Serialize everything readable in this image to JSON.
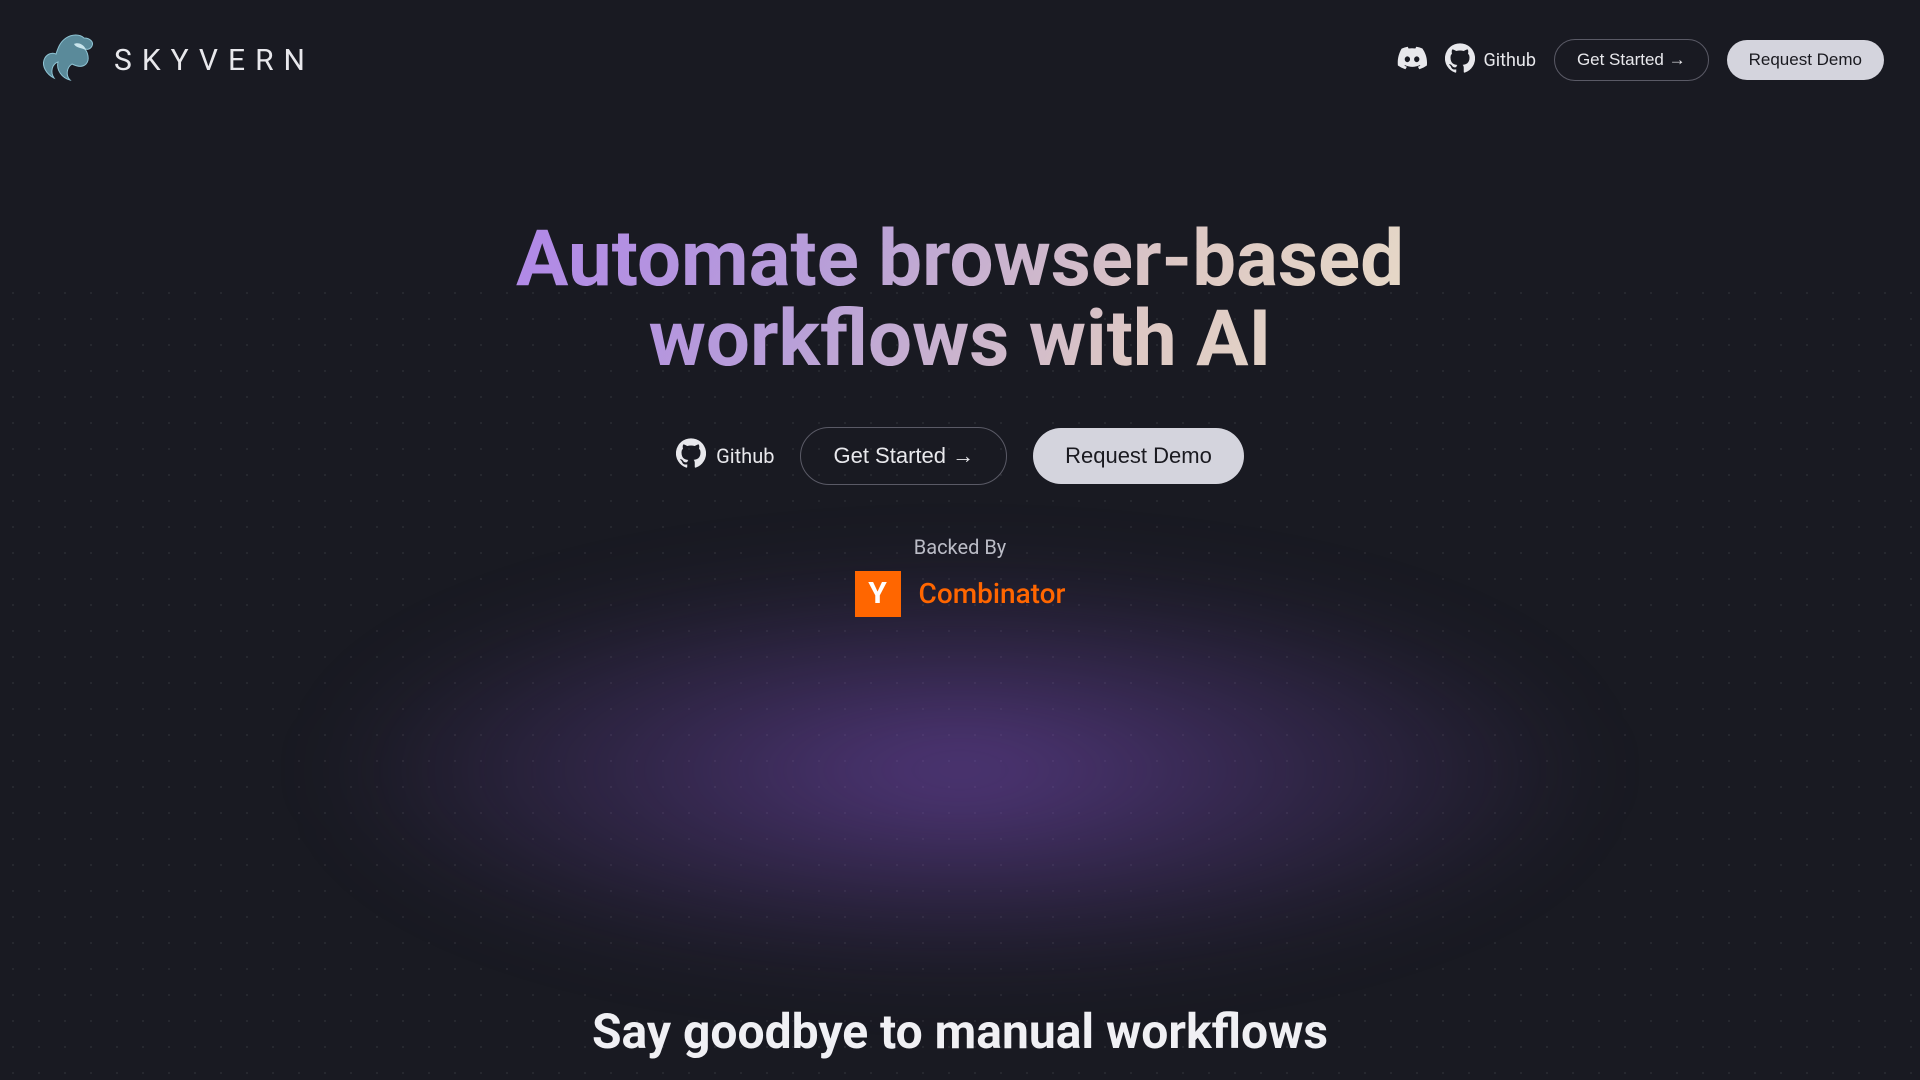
{
  "brand": {
    "name": "SKYVERN"
  },
  "nav": {
    "github_label": "Github",
    "get_started_label": "Get Started →",
    "request_demo_label": "Request Demo"
  },
  "hero": {
    "title": "Automate browser-based workflows with AI",
    "github_label": "Github",
    "get_started_label": "Get Started →",
    "request_demo_label": "Request Demo",
    "backed_by_label": "Backed By",
    "yc_letter": "Y",
    "yc_name": "Combinator"
  },
  "section": {
    "heading": "Say goodbye to manual workflows"
  }
}
